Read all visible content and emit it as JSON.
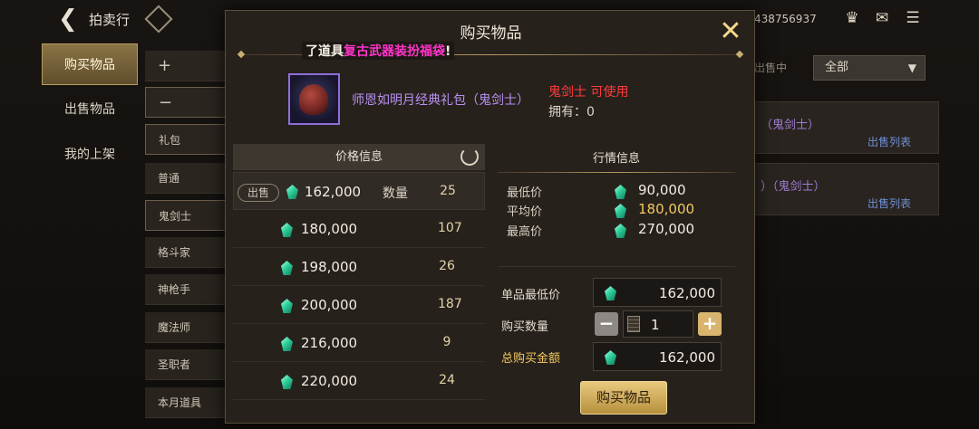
{
  "topbar": {
    "title": "拍卖行",
    "uid": "438756937"
  },
  "nav": {
    "tabs": [
      "购买物品",
      "出售物品",
      "我的上架"
    ]
  },
  "categories": {
    "plus": "+",
    "minus": "−",
    "items": [
      "礼包",
      "普通",
      "鬼剑士",
      "格斗家",
      "神枪手",
      "魔法师",
      "圣职者",
      "本月道具"
    ]
  },
  "background_right": {
    "label": "出售中",
    "filter_value": "全部",
    "rows": [
      {
        "name": "（鬼剑士）",
        "link": "出售列表"
      },
      {
        "name": "）（鬼剑士）",
        "link": "出售列表"
      }
    ]
  },
  "modal": {
    "title": "购买物品",
    "notice_prefix": "了道具",
    "notice_highlight": "复古武器装扮福袋",
    "notice_suffix": "!",
    "item": {
      "name": "师恩如明月经典礼包（鬼剑士）",
      "usable_text": "鬼剑士 可使用",
      "owned_text": "拥有：0"
    },
    "price_info": {
      "title": "价格信息",
      "sell_tag": "出售",
      "qty_label": "数量",
      "rows": [
        {
          "price": "162,000",
          "qty": "25"
        },
        {
          "price": "180,000",
          "qty": "107"
        },
        {
          "price": "198,000",
          "qty": "26"
        },
        {
          "price": "200,000",
          "qty": "187"
        },
        {
          "price": "216,000",
          "qty": "9"
        },
        {
          "price": "220,000",
          "qty": "24"
        }
      ]
    },
    "market": {
      "title": "行情信息",
      "min_label": "最低价",
      "min_value": "90,000",
      "avg_label": "平均价",
      "avg_value": "180,000",
      "max_label": "最高价",
      "max_value": "270,000"
    },
    "buy_form": {
      "unit_label": "单品最低价",
      "unit_value": "162,000",
      "qty_label": "购买数量",
      "qty_value": "1",
      "total_label": "总购买金额",
      "total_value": "162,000",
      "buy_button": "购买物品"
    }
  },
  "colors": {
    "accent_gold": "#d8b46e",
    "purple_item": "#b790f0",
    "red_usable": "#ff3b3b",
    "magenta_notice": "#ff34c8",
    "avg_gold": "#f2c95f"
  }
}
